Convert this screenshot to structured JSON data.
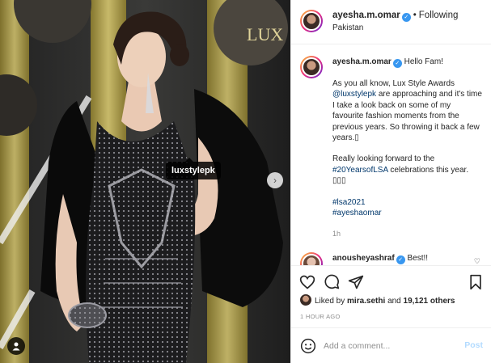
{
  "media": {
    "tag_label": "luxstylepk",
    "next_arrow": "›",
    "user_tag_icon": "user-icon",
    "backdrop_logo": "LUX"
  },
  "header": {
    "username": "ayesha.m.omar",
    "separator": "•",
    "follow_label": "Following",
    "location": "Pakistan"
  },
  "caption": {
    "username": "ayesha.m.omar",
    "lines": [
      "Hello Fam!",
      "As you all know, Lux Style Awards",
      "are approaching and it's time I take a look back on some of my favourite fashion moments from the previous years. So throwing it back a few years.▯"
    ],
    "mention": "@luxstylepk",
    "line2": "Really looking forward to the",
    "hashtag_lsa20": "#20YearsofLSA",
    "line2_tail": "celebrations this year.",
    "boxes": "▯▯▯",
    "hashtags": [
      "#lsa2021",
      "#ayeshaomar"
    ],
    "time": "1h"
  },
  "comment": {
    "username": "anousheyashraf",
    "text": "Best!!"
  },
  "likes": {
    "prefix": "Liked by",
    "user": "mira.sethi",
    "and": "and",
    "count": "19,121 others"
  },
  "posted": "1 HOUR AGO",
  "add_comment": {
    "placeholder": "Add a comment...",
    "post_label": "Post"
  },
  "colors": {
    "verified": "#3897f0",
    "link": "#00376b",
    "post_disabled": "#b3dbff",
    "muted": "#8e8e8e"
  }
}
